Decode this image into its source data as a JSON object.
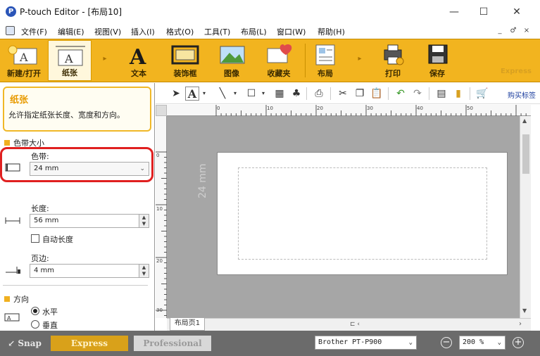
{
  "window": {
    "title": "P-touch Editor - [布局10]",
    "minimize": "—",
    "maximize": "☐",
    "close": "✕"
  },
  "menu": {
    "items": [
      "文件(F)",
      "编辑(E)",
      "视图(V)",
      "插入(I)",
      "格式(O)",
      "工具(T)",
      "布局(L)",
      "窗口(W)",
      "帮助(H)"
    ],
    "mdi_buttons": [
      "_",
      "♂",
      "×"
    ]
  },
  "ribbon": {
    "buttons": [
      "新建/打开",
      "纸张",
      "文本",
      "装饰框",
      "图像",
      "收藏夹",
      "布局",
      "打印",
      "保存"
    ],
    "selected": "纸张",
    "express_watermark": "Express",
    "accent": "#f2b41f"
  },
  "panel": {
    "help_title": "纸张",
    "help_desc": "允许指定纸张长度、宽度和方向。",
    "section_tape_size": "色带大小",
    "tape_label": "色带:",
    "tape_value": "24 mm",
    "length_label": "长度:",
    "length_value": "56 mm",
    "auto_length_label": "自动长度",
    "margin_label": "页边:",
    "margin_value": "4 mm",
    "section_orientation": "方向",
    "orientation_horizontal": "水平",
    "orientation_vertical": "垂直",
    "highlight_color": "#e02020"
  },
  "toolbar": {
    "buy_link": "购买标签"
  },
  "ruler": {
    "h_ticks": [
      "0",
      "10",
      "20",
      "30",
      "40",
      "50"
    ],
    "v_ticks": [
      "0",
      "10",
      "20",
      "30"
    ]
  },
  "canvas": {
    "tape_width_text": "24 mm",
    "page_tab": "布局页1"
  },
  "status": {
    "snap": "Snap",
    "express": "Express",
    "professional": "Professional",
    "printer": "Brother PT-P900",
    "zoom": "200 %"
  }
}
